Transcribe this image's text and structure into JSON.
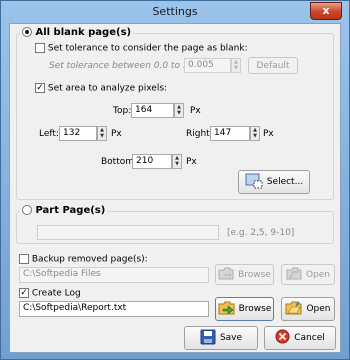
{
  "window": {
    "title": "Settings",
    "close_glyph": "x"
  },
  "all_blank": {
    "label": "All blank page(s)",
    "tolerance_check_label": "Set tolerance to consider the page as blank:",
    "tolerance_hint": "Set tolerance between 0.0 to 1.0.",
    "tolerance_value": "0.005",
    "default_label": "Default",
    "area_check_label": "Set area to analyze pixels:",
    "top_label": "Top:",
    "top_value": "164",
    "top_unit": "Px",
    "left_label": "Left:",
    "left_value": "132",
    "left_unit": "Px",
    "right_label": "Right:",
    "right_value": "147",
    "right_unit": "Px",
    "bottom_label": "Bottom:",
    "bottom_value": "210",
    "bottom_unit": "Px",
    "select_label": "Select..."
  },
  "part_pages": {
    "label": "Part Page(s)",
    "input_value": "",
    "hint": "[e.g. 2,5, 9-10]"
  },
  "backup": {
    "label": "Backup removed page(s):",
    "path": "C:\\Softpedia Files",
    "browse_label": "Browse",
    "open_label": "Open"
  },
  "log": {
    "label": "Create Log",
    "path": "C:\\Softpedia\\Report.txt",
    "browse_label": "Browse",
    "open_label": "Open"
  },
  "footer": {
    "save_label": "Save",
    "cancel_label": "Cancel"
  }
}
